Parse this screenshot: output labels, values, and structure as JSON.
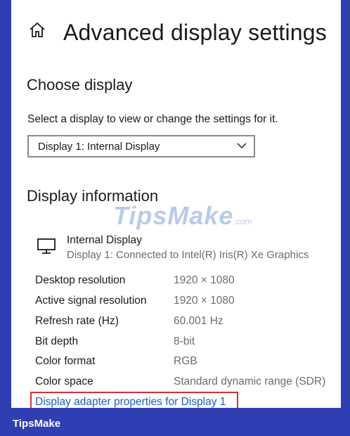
{
  "header": {
    "title": "Advanced display settings",
    "home_icon": "home-icon"
  },
  "choose_display": {
    "title": "Choose display",
    "description": "Select a display to view or change the settings for it.",
    "selected": "Display 1: Internal Display"
  },
  "display_info": {
    "title": "Display information",
    "display_name": "Internal Display",
    "display_sub": "Display 1: Connected to Intel(R) Iris(R) Xe Graphics",
    "rows": [
      {
        "label": "Desktop resolution",
        "value": "1920 × 1080"
      },
      {
        "label": "Active signal resolution",
        "value": "1920 × 1080"
      },
      {
        "label": "Refresh rate (Hz)",
        "value": "60.001 Hz"
      },
      {
        "label": "Bit depth",
        "value": "8-bit"
      },
      {
        "label": "Color format",
        "value": "RGB"
      },
      {
        "label": "Color space",
        "value": "Standard dynamic range (SDR)"
      }
    ],
    "adapter_link": "Display adapter properties for Display 1"
  },
  "watermark": {
    "brand": "TipsMake",
    "suffix": ".com"
  },
  "footer": {
    "brand": "TipsMake"
  },
  "colors": {
    "frame": "#2f3fb3",
    "link": "#1b5fb0",
    "highlight": "#d6303a",
    "watermark": "#b9cbe8"
  }
}
